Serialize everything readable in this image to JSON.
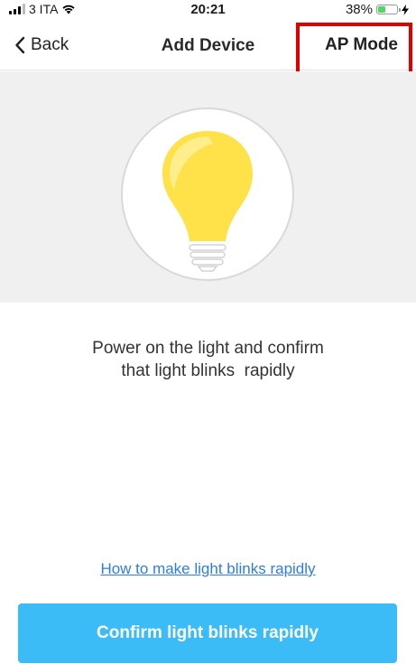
{
  "status_bar": {
    "carrier": "3 ITA",
    "time": "20:21",
    "battery_percent_label": "38%",
    "battery_level": 0.38
  },
  "nav": {
    "back_label": "Back",
    "title": "Add Device",
    "ap_mode_label": "AP Mode"
  },
  "illustration": {
    "icon": "light-bulb-icon",
    "bulb_color": "#ffe24a",
    "bulb_highlight": "#fff3a6"
  },
  "instruction": {
    "line1": "Power on the light and confirm",
    "line2": "that light blinks  rapidly"
  },
  "help_link": {
    "label": "How to make light blinks rapidly"
  },
  "confirm_button": {
    "label": "Confirm light blinks rapidly"
  },
  "colors": {
    "accent": "#3cbcf7",
    "link": "#2f7de1",
    "highlight_outline": "#e00000",
    "battery": "#4cd964"
  }
}
